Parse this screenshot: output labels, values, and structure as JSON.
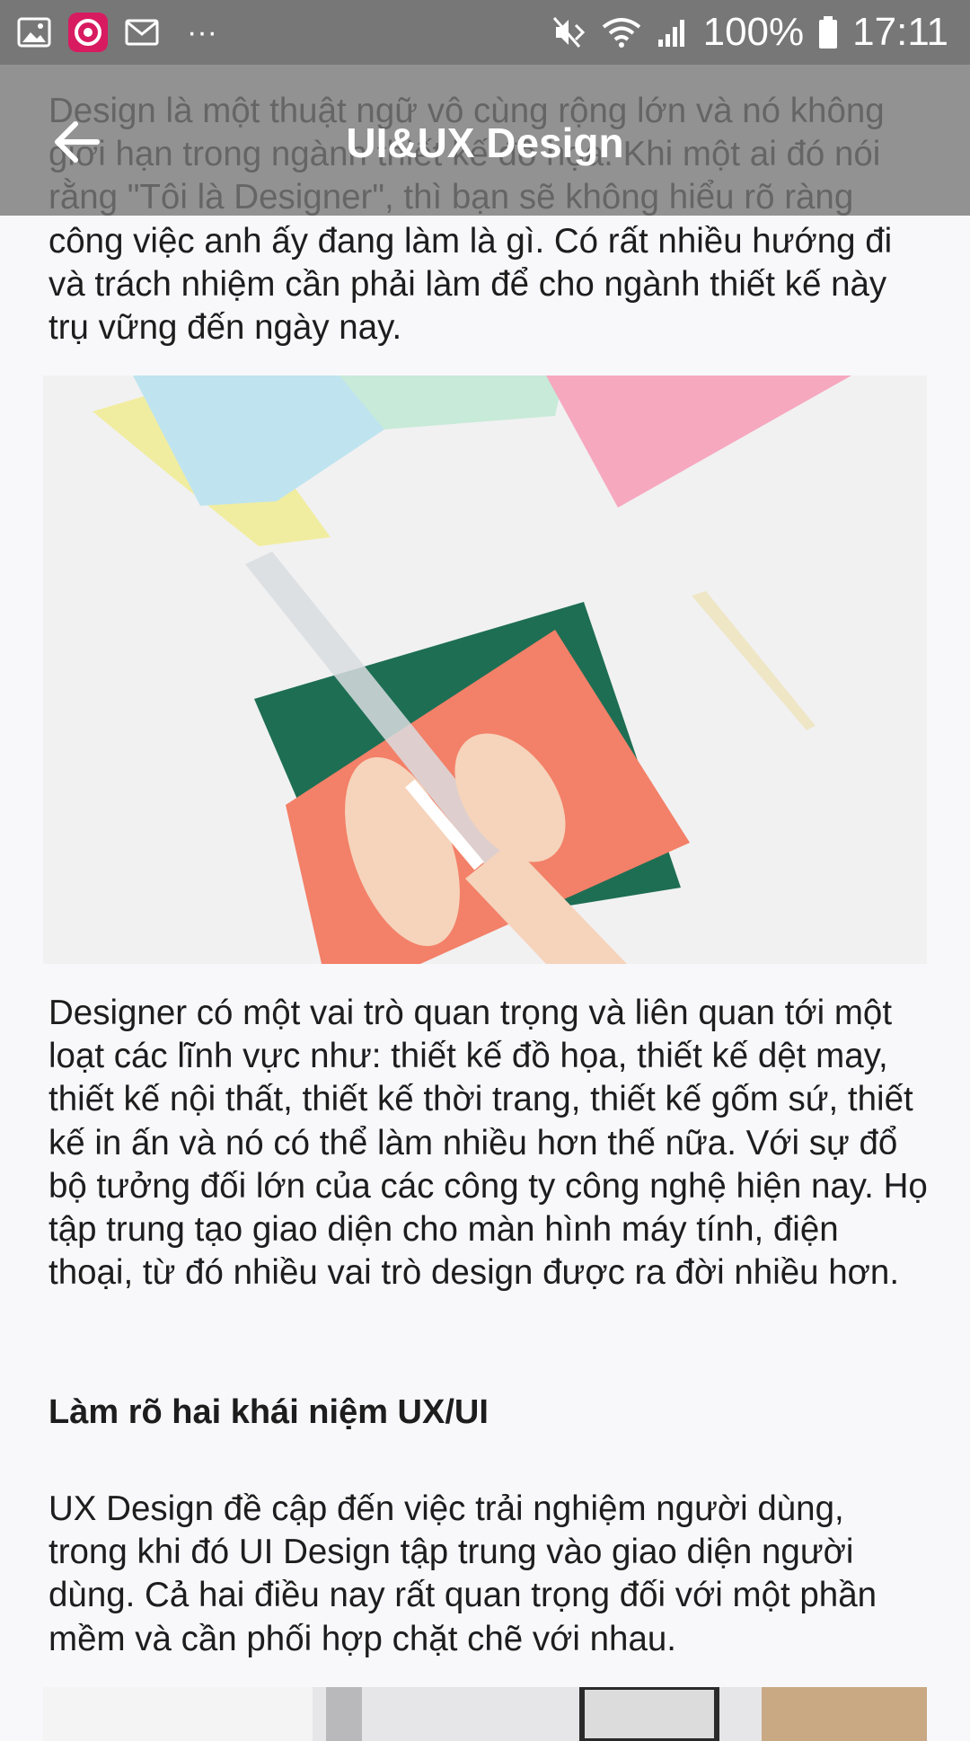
{
  "status_bar": {
    "left_icons": [
      "image-icon",
      "app-swirl-icon",
      "mail-icon",
      "more-dots-icon"
    ],
    "more": "···",
    "battery": "100%",
    "time": "17:11"
  },
  "toolbar": {
    "title": "UI&UX Design",
    "back_icon": "arrow-left-icon"
  },
  "article": {
    "para1": "Design là một thuật ngữ vô cùng rộng lớn và nó không giới hạn trong ngành thiết kế đồ họa. Khi một ai đó nói rằng \"Tôi là Designer\", thì bạn sẽ không hiểu rõ ràng công việc anh ấy đang làm là gì. Có rất nhiều hướng đi và trách nhiệm cần phải làm để cho ngành thiết kế này trụ vững đến ngày nay.",
    "para2": "Designer có một vai trò quan trọng và liên quan tới một loạt các lĩnh vực như: thiết kế đồ họa, thiết kế dệt may, thiết kế nội thất, thiết kế thời trang, thiết kế gốm sứ, thiết kế in ấn và nó có thể làm nhiều hơn thế nữa. Với sự đổ bộ tưởng đối lớn của các công ty công nghệ hiện nay. Họ tập trung tạo giao diện cho màn hình máy tính, điện thoại, từ đó nhiều vai trò design được ra đời nhiều hơn.",
    "heading": "Làm rõ hai khái niệm UX/UI",
    "para3": "UX Design đề cập đến việc trải nghiệm người dùng, trong khi đó UI Design tập trung vào giao diện người dùng. Cả hai điều nay rất quan trọng đối với một phần mềm và cần phối hợp chặt chẽ với nhau."
  },
  "colors": {
    "status_bar": "#777777",
    "toolbar": "#7a7a7a",
    "background": "#f8f8fa",
    "text": "#1d1d1d"
  }
}
